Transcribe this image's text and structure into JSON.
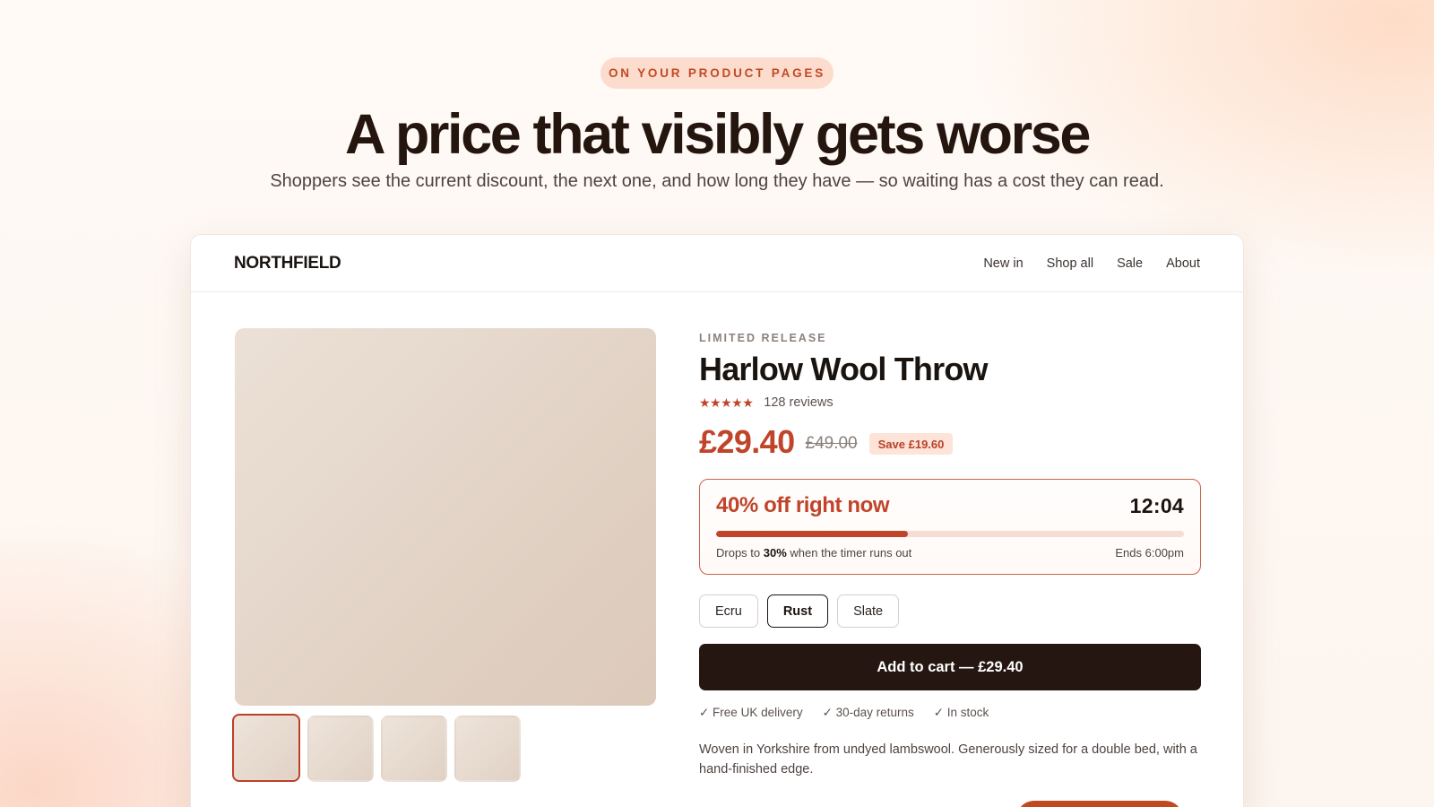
{
  "hero": {
    "eyebrow": "ON YOUR PRODUCT PAGES",
    "headline": "A price that visibly gets worse",
    "subline": "Shoppers see the current discount, the next one, and how long they have — so waiting has a cost they can read."
  },
  "store": {
    "brand": "NORTHFIELD",
    "nav": [
      "New in",
      "Shop all",
      "Sale",
      "About"
    ]
  },
  "gallery": {
    "thumbnails": 4,
    "active_thumbnail": 1
  },
  "product": {
    "kicker": "LIMITED RELEASE",
    "title": "Harlow Wool Throw",
    "stars": "★★★★★",
    "reviews": "128 reviews",
    "price_now": "£29.40",
    "price_was": "£49.00",
    "save_badge": "Save £19.60",
    "description": "Woven in Yorkshire from undyed lambswool. Generously sized for a double bed, with a hand-finished edge."
  },
  "timer": {
    "headline": "40% off right now",
    "countdown": "12:04",
    "progress_fraction": 0.41,
    "drops_prefix": "Drops to",
    "drops_value": "30%",
    "drops_suffix": "when the timer runs out",
    "ends": "Ends 6:00pm"
  },
  "variants": {
    "options": [
      "Ecru",
      "Rust",
      "Slate"
    ],
    "selected": "Rust"
  },
  "cart": {
    "button_label": "Add to cart — £29.40"
  },
  "perks": [
    "✓ Free UK delivery",
    "✓ 30-day returns",
    "✓ In stock"
  ],
  "colors": {
    "accent": "#c0442a",
    "dark": "#251611",
    "badge_bg": "#fde3d8",
    "eyebrow_bg": "#fcdccd"
  }
}
